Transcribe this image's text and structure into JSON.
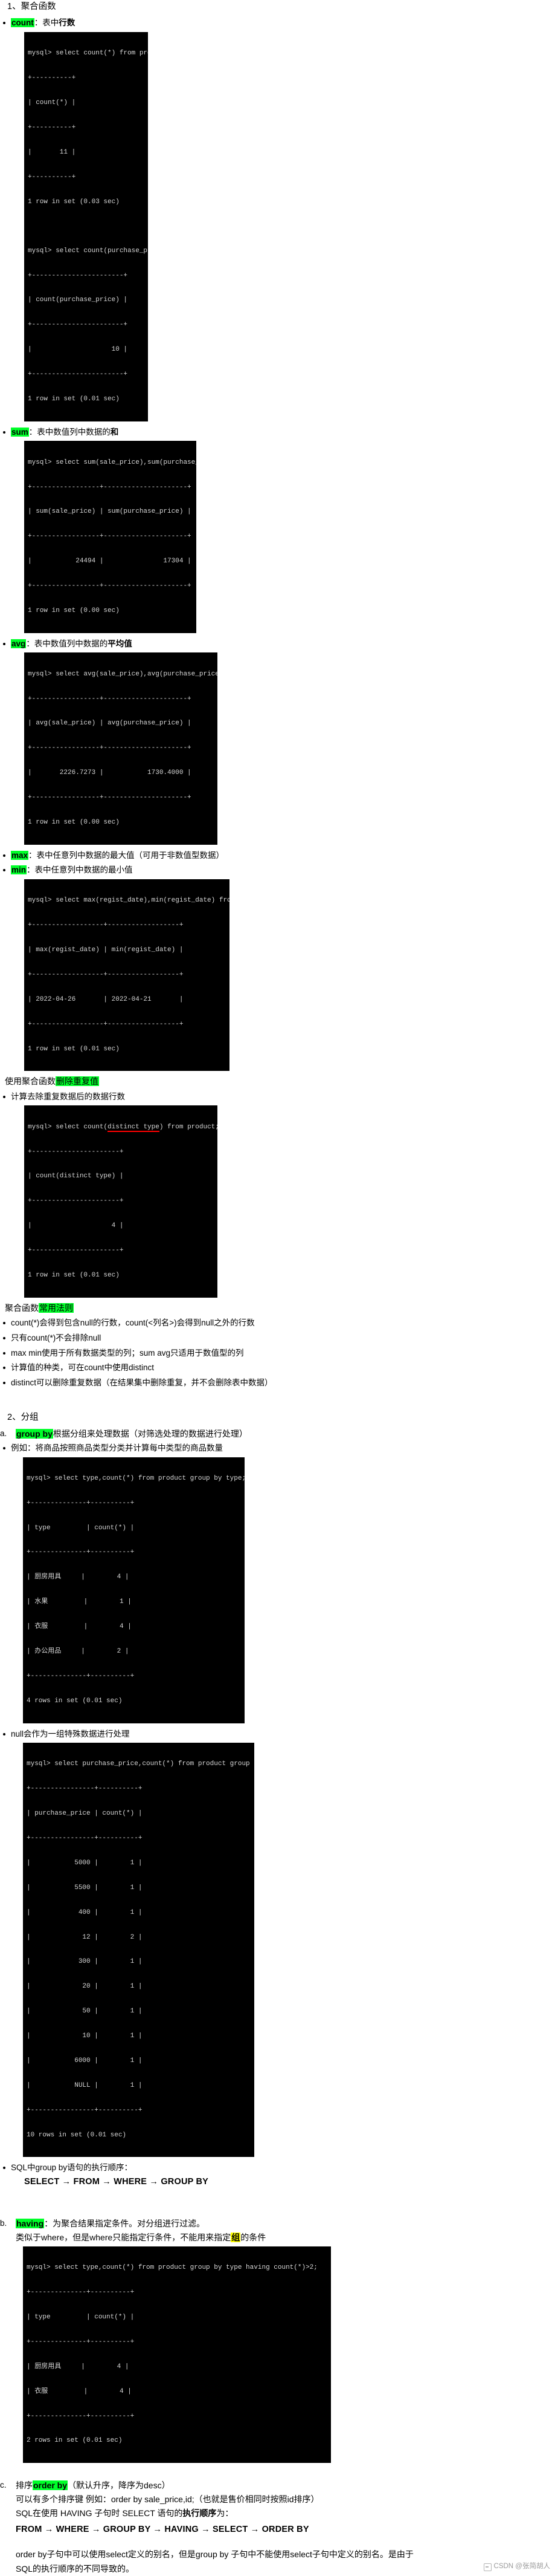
{
  "section1": {
    "heading": "1、聚合函数",
    "items": [
      {
        "kw": "count",
        "rest": "：表中",
        "bold_tail": "行数"
      },
      {
        "kw": "sum",
        "rest": "：表中数值列中数据的",
        "bold_tail": "和"
      },
      {
        "kw": "avg",
        "rest": "：表中数值列中数据的",
        "bold_tail": "平均值"
      },
      {
        "kw": "max",
        "rest": "：表中任意列中数据的最大值（可用于非数值型数据）",
        "bold_tail": ""
      },
      {
        "kw": "min",
        "rest": "：表中任意列中数据的最小值",
        "bold_tail": ""
      }
    ],
    "terminal_count": [
      "mysql> select count(*) from product;",
      "+----------+",
      "| count(*) |",
      "+----------+",
      "|       11 |",
      "+----------+",
      "1 row in set (0.03 sec)",
      "",
      "mysql> select count(purchase_price) from product;",
      "+-----------------------+",
      "| count(purchase_price) |",
      "+-----------------------+",
      "|                    10 |",
      "+-----------------------+",
      "1 row in set (0.01 sec)"
    ],
    "terminal_sum": [
      "mysql> select sum(sale_price),sum(purchase_price) from product;",
      "+-----------------+---------------------+",
      "| sum(sale_price) | sum(purchase_price) |",
      "+-----------------+---------------------+",
      "|           24494 |               17304 |",
      "+-----------------+---------------------+",
      "1 row in set (0.00 sec)"
    ],
    "terminal_avg": [
      "mysql> select avg(sale_price),avg(purchase_price) from product;",
      "+-----------------+---------------------+",
      "| avg(sale_price) | avg(purchase_price) |",
      "+-----------------+---------------------+",
      "|       2226.7273 |           1730.4000 |",
      "+-----------------+---------------------+",
      "1 row in set (0.00 sec)"
    ],
    "terminal_maxmin": [
      "mysql> select max(regist_date),min(regist_date) from product;",
      "+------------------+------------------+",
      "| max(regist_date) | min(regist_date) |",
      "+------------------+------------------+",
      "| 2022-04-26       | 2022-04-21       |",
      "+------------------+------------------+",
      "1 row in set (0.01 sec)"
    ]
  },
  "distinct_block": {
    "title_prefix": "使用聚合函数",
    "title_hl": "删除重复值",
    "bullet": "计算去除重复数据后的数据行数",
    "terminal_pre": "mysql> select count(",
    "terminal_underlined": "distinct type",
    "terminal_post": ") from product;",
    "terminal_rest": [
      "+----------------------+",
      "| count(distinct type) |",
      "+----------------------+",
      "|                    4 |",
      "+----------------------+",
      "1 row in set (0.01 sec)"
    ]
  },
  "rules_block": {
    "title_prefix": "聚合函数",
    "title_hl": "常用法则",
    "items": [
      "count(*)会得到包含null的行数，count(<列名>)会得到null之外的行数",
      "只有count(*)不会排除null",
      "max min使用于所有数据类型的列；sum avg只适用于数值型的列",
      "计算值的种类，可在count中使用distinct",
      "distinct可以删除重复数据（在结果集中删除重复，并不会删除表中数据）"
    ]
  },
  "section2": {
    "heading": "2、分组",
    "a": {
      "marker": "a.",
      "kw": "group by",
      "rest": "根据分组来处理数据（对筛选处理的数据进行处理）",
      "bullet_example": "例如：将商品按照商品类型分类并计算每中类型的商品数量",
      "terminal_group": [
        "mysql> select type,count(*) from product group by type;",
        "+--------------+----------+",
        "| type         | count(*) |",
        "+--------------+----------+",
        "| 厨房用具     |        4 |",
        "| 水果         |        1 |",
        "| 衣服         |        4 |",
        "| 办公用品     |        2 |",
        "+--------------+----------+",
        "4 rows in set (0.01 sec)"
      ],
      "bullet_null": "null会作为一组特殊数据进行处理",
      "terminal_null": [
        "mysql> select purchase_price,count(*) from product group by purchase_price;",
        "+----------------+----------+",
        "| purchase_price | count(*) |",
        "+----------------+----------+",
        "|           5000 |        1 |",
        "|           5500 |        1 |",
        "|            400 |        1 |",
        "|             12 |        2 |",
        "|            300 |        1 |",
        "|             20 |        1 |",
        "|             50 |        1 |",
        "|             10 |        1 |",
        "|           6000 |        1 |",
        "|           NULL |        1 |",
        "+----------------+----------+",
        "10 rows in set (0.01 sec)"
      ],
      "bullet_order": "SQL中group by语句的执行顺序：",
      "order_seq": "SELECT →  FROM → WHERE → GROUP BY"
    },
    "b": {
      "marker": "b.",
      "kw": "having",
      "rest": "：为聚合结果指定条件。对分组进行过滤。",
      "line2_pre": "类似于where，但是where只能指定行条件，不能用来指定",
      "line2_hl": "组",
      "line2_post": "的条件",
      "terminal_having": [
        "mysql> select type,count(*) from product group by type having count(*)>2;",
        "+--------------+----------+",
        "| type         | count(*) |",
        "+--------------+----------+",
        "| 厨房用具     |        4 |",
        "| 衣服         |        4 |",
        "+--------------+----------+",
        "2 rows in set (0.01 sec)"
      ]
    },
    "c": {
      "marker": "c.",
      "prefix": "排序",
      "kw": "order by",
      "rest": "（默认升序，降序为desc）",
      "line2": "可以有多个排序键  例如：order by sale_price,id;（也就是售价相同时按照id排序）",
      "line3_pre": "SQL在使用 HAVING 子句时 SELECT 语句的",
      "line3_bold": "执行顺序",
      "line3_post": "为：",
      "order_seq": "FROM → WHERE → GROUP BY → HAVING → SELECT → ORDER BY",
      "note_line1": "order by子句中可以使用select定义的别名，但是group by 子句中不能使用select子句中定义的别名。是由于",
      "note_line2": "SQL的执行顺序的不同导致的。"
    }
  },
  "footer": {
    "watermark": "CSDN @张简胡人"
  }
}
